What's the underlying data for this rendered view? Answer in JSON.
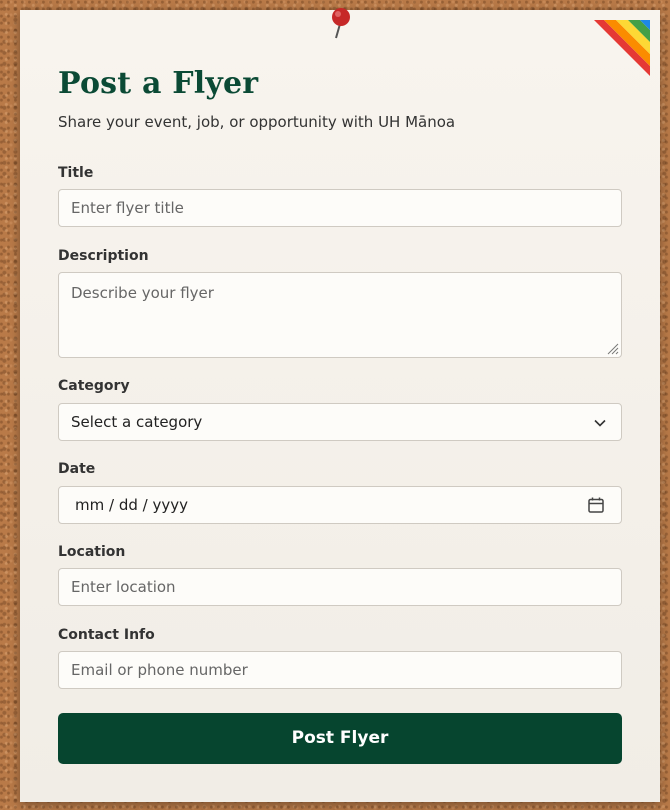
{
  "form": {
    "title": "Post a Flyer",
    "subtitle": "Share your event, job, or opportunity with UH Mānoa",
    "fields": {
      "title": {
        "label": "Title",
        "placeholder": "Enter flyer title"
      },
      "description": {
        "label": "Description",
        "placeholder": "Describe your flyer"
      },
      "category": {
        "label": "Category",
        "selected": "Select a category"
      },
      "date": {
        "label": "Date",
        "value": "mm / dd / yyyy"
      },
      "location": {
        "label": "Location",
        "placeholder": "Enter location"
      },
      "contact": {
        "label": "Contact Info",
        "placeholder": "Email or phone number"
      }
    },
    "submit_label": "Post Flyer"
  },
  "icons": {
    "pin": "push-pin-icon",
    "corner": "rainbow-corner-icon",
    "chevron": "chevron-down-icon",
    "calendar": "calendar-icon",
    "resize": "resize-handle-icon"
  },
  "colors": {
    "brand_green": "#06452f",
    "heading_green": "#0b4a35",
    "cork": "#b97a48",
    "card": "#f8f4ee",
    "pin_red": "#c62828"
  }
}
